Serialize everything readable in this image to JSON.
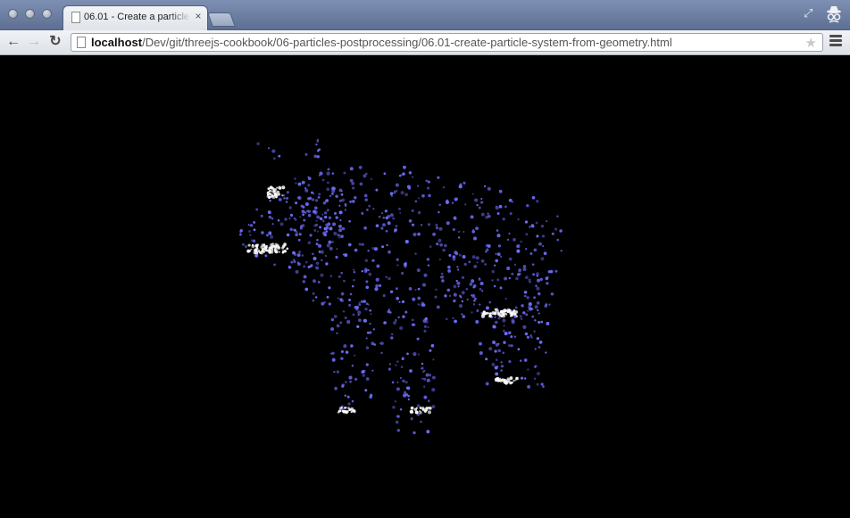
{
  "tab": {
    "title": "06.01 - Create a particle s"
  },
  "address_bar": {
    "host": "localhost",
    "path": "/Dev/git/threejs-cookbook/06-particles-postprocessing/06.01-create-particle-system-from-geometry.html"
  },
  "icons": {
    "back": "back-arrow-icon",
    "forward": "forward-arrow-icon",
    "reload": "reload-icon",
    "star": "star-icon",
    "menu": "hamburger-menu-icon",
    "incognito": "incognito-icon",
    "resize": "fullscreen-icon"
  },
  "scene": {
    "background": "#000000",
    "particle_color": "#6f6fff",
    "highlight_color": "#ffffff",
    "subject": "cow"
  }
}
